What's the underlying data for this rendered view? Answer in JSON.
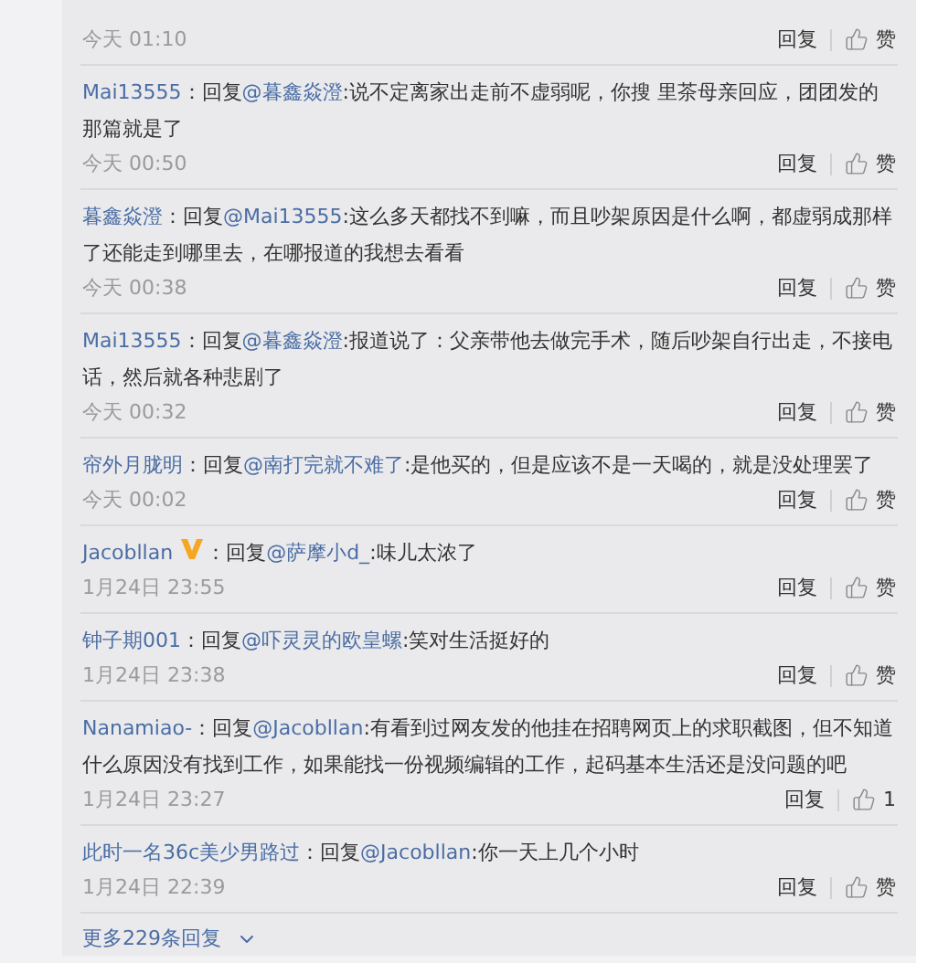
{
  "comments": [
    {
      "kind": "cut",
      "time": "今天 01:10",
      "reply": "回复",
      "likes": "赞"
    },
    {
      "kind": "full",
      "user": "Mai13555",
      "verified": false,
      "sep": "：回复",
      "mention": "@暮鑫焱澄",
      "text": ":说不定离家出走前不虚弱呢，你搜 里茶母亲回应，团团发的那篇就是了",
      "time": "今天 00:50",
      "reply": "回复",
      "likes": "赞"
    },
    {
      "kind": "full",
      "user": "暮鑫焱澄",
      "verified": false,
      "sep": "：回复",
      "mention": "@Mai13555",
      "text": ":这么多天都找不到嘛，而且吵架原因是什么啊，都虚弱成那样了还能走到哪里去，在哪报道的我想去看看",
      "time": "今天 00:38",
      "reply": "回复",
      "likes": "赞"
    },
    {
      "kind": "full",
      "user": "Mai13555",
      "verified": false,
      "sep": "：回复",
      "mention": "@暮鑫焱澄",
      "text": ":报道说了：父亲带他去做完手术，随后吵架自行出走，不接电话，然后就各种悲剧了",
      "time": "今天 00:32",
      "reply": "回复",
      "likes": "赞"
    },
    {
      "kind": "full",
      "user": "帘外月胧明",
      "verified": false,
      "sep": "：回复",
      "mention": "@南打完就不难了",
      "text": ":是他买的，但是应该不是一天喝的，就是没处理罢了",
      "time": "今天 00:02",
      "reply": "回复",
      "likes": "赞"
    },
    {
      "kind": "full",
      "user": "Jacobllan",
      "verified": true,
      "sep": "：回复",
      "mention": "@萨摩小d_",
      "text": ":味儿太浓了",
      "time": "1月24日 23:55",
      "reply": "回复",
      "likes": "赞"
    },
    {
      "kind": "full",
      "user": "钟子期001",
      "verified": false,
      "sep": "：回复",
      "mention": "@吓灵灵的欧皇螺",
      "text": ":笑对生活挺好的",
      "time": "1月24日 23:38",
      "reply": "回复",
      "likes": "赞"
    },
    {
      "kind": "full",
      "user": "Nanamiao-",
      "verified": false,
      "sep": "：回复",
      "mention": "@Jacobllan",
      "text": ":有看到过网友发的他挂在招聘网页上的求职截图，但不知道什么原因没有找到工作，如果能找一份视频编辑的工作，起码基本生活还是没问题的吧",
      "time": "1月24日 23:27",
      "reply": "回复",
      "likes": "1"
    },
    {
      "kind": "full",
      "user": "此时一名36c美少男路过",
      "verified": false,
      "sep": "：回复",
      "mention": "@Jacobllan",
      "text": ":你一天上几个小时",
      "time": "1月24日 22:39",
      "reply": "回复",
      "likes": "赞"
    }
  ],
  "more": {
    "label": "更多229条回复"
  }
}
